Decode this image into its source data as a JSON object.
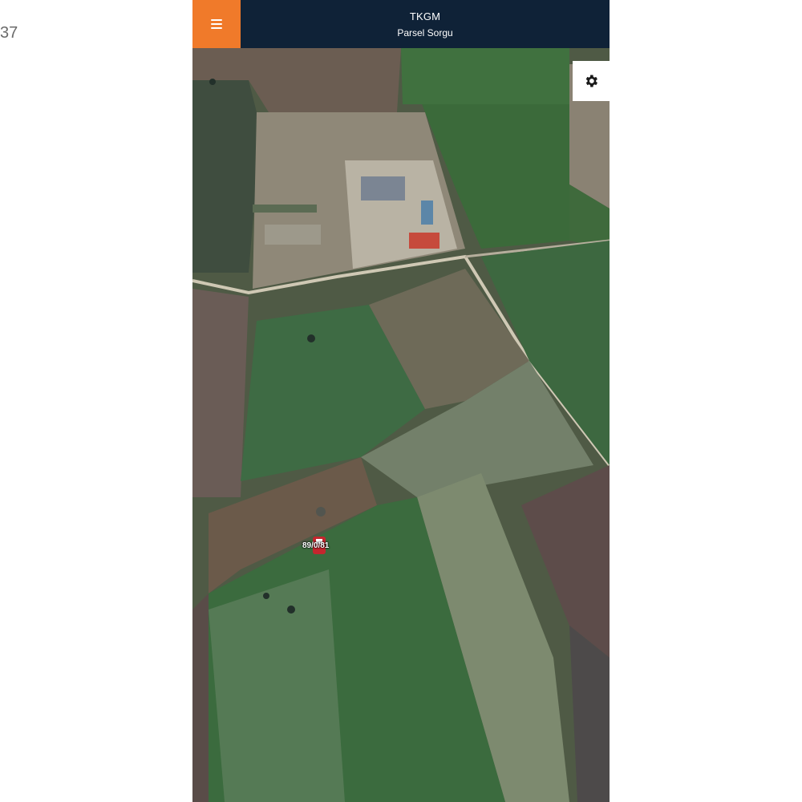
{
  "side_text": "37",
  "header": {
    "title": "TKGM",
    "subtitle": "Parsel Sorgu"
  },
  "icons": {
    "menu": "hamburger-menu-icon",
    "settings": "gear-icon",
    "parcel_marker": "map-pin-icon"
  },
  "map": {
    "parcel_label": "89/0/81"
  },
  "colors": {
    "header_bg": "#0f2237",
    "menu_bg": "#f07a2a",
    "header_text": "#ffffff"
  }
}
